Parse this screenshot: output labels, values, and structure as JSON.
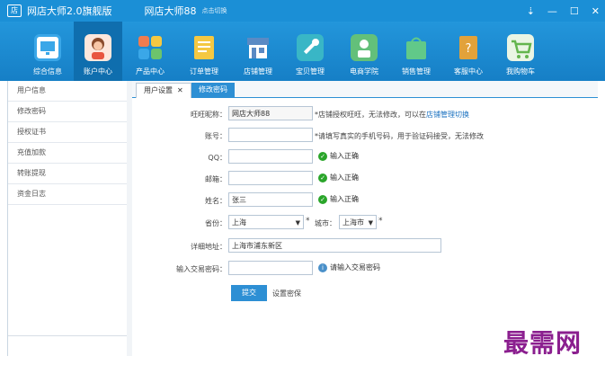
{
  "titlebar": {
    "logo": "店",
    "app_title": "网店大师2.0旗舰版",
    "shop_name": "网店大师88",
    "switch_label": "点击切换",
    "controls": [
      "⇣",
      "—",
      "☐",
      "✕"
    ]
  },
  "toolbar": {
    "items": [
      {
        "label": "综合信息",
        "icon": "monitor-icon",
        "color": "#3aa7e8"
      },
      {
        "label": "账户中心",
        "icon": "user-avatar-icon",
        "color": "#f3a37a"
      },
      {
        "label": "产品中心",
        "icon": "product-tiles-icon",
        "color": "#f07c4f"
      },
      {
        "label": "订单管理",
        "icon": "document-icon",
        "color": "#f4c842"
      },
      {
        "label": "店铺管理",
        "icon": "store-icon",
        "color": "#5a8ac4"
      },
      {
        "label": "宝贝管理",
        "icon": "tools-icon",
        "color": "#39b6c6"
      },
      {
        "label": "电商学院",
        "icon": "academy-icon",
        "color": "#63c07a"
      },
      {
        "label": "销售管理",
        "icon": "bag-icon",
        "color": "#61c989"
      },
      {
        "label": "客服中心",
        "icon": "book-icon",
        "color": "#e2a23a"
      },
      {
        "label": "我购物车",
        "icon": "cart-icon",
        "color": "#64b54e"
      }
    ]
  },
  "sidebar": {
    "items": [
      "用户信息",
      "修改密码",
      "授权证书",
      "充值加款",
      "转账提现",
      "资金日志"
    ]
  },
  "tabs": {
    "tab1": "用户设置",
    "tab1_close": "✕",
    "tab2": "修改密码"
  },
  "form": {
    "wangwang_label": "旺旺昵称：",
    "wangwang_value": "网店大师88",
    "wangwang_hint": "*店铺授权旺旺，无法修改，可以在",
    "wangwang_link": "店铺管理切换",
    "account_label": "账号：",
    "account_value": "",
    "account_hint": "*请填写真实的手机号码，用于验证码接受，无法修改",
    "qq_label": "QQ：",
    "qq_value": "",
    "qq_ok": "输入正确",
    "email_label": "邮箱：",
    "email_value": "",
    "email_ok": "输入正确",
    "name_label": "姓名：",
    "name_value": "张三",
    "name_ok": "输入正确",
    "province_label": "省份：",
    "province_value": "上海",
    "province_req": "*",
    "city_label": "城市：",
    "city_value": "上海市",
    "city_req": "*",
    "address_label": "详细地址：",
    "address_value": "上海市浦东新区",
    "trade_pwd_label": "输入交易密码：",
    "trade_pwd_value": "",
    "trade_pwd_hint": "请输入交易密码",
    "submit_label": "提交",
    "reset_label": "设置密保"
  },
  "watermark": "最需网"
}
